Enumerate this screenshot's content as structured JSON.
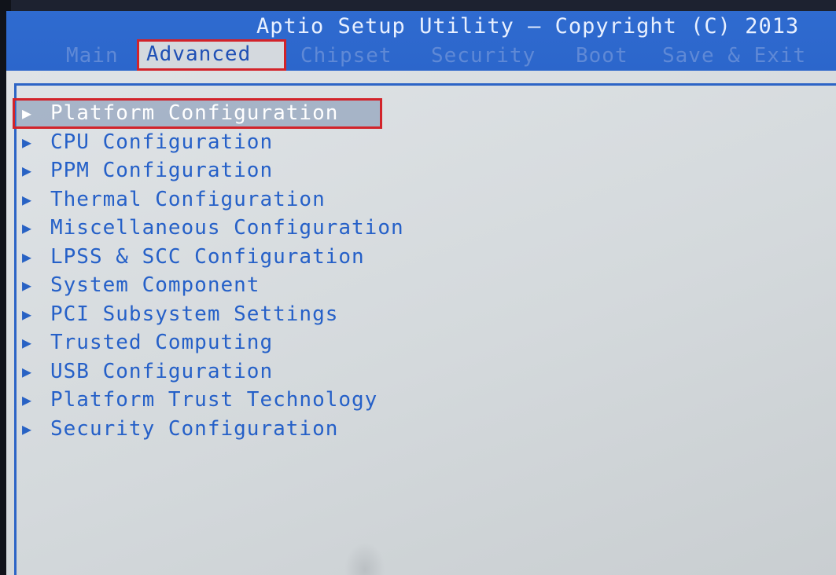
{
  "header": {
    "title": "Aptio Setup Utility – Copyright (C) 2013"
  },
  "tabs": [
    {
      "label": "Main"
    },
    {
      "label": "Advanced",
      "active": true
    },
    {
      "label": "Chipset"
    },
    {
      "label": "Security"
    },
    {
      "label": "Boot"
    },
    {
      "label": "Save & Exit"
    }
  ],
  "menu": {
    "items": [
      {
        "label": "Platform Configuration",
        "selected": true
      },
      {
        "label": "CPU Configuration"
      },
      {
        "label": "PPM Configuration"
      },
      {
        "label": "Thermal Configuration"
      },
      {
        "label": "Miscellaneous Configuration"
      },
      {
        "label": "LPSS & SCC Configuration"
      },
      {
        "label": "System Component"
      },
      {
        "label": "PCI Subsystem Settings"
      },
      {
        "label": "Trusted Computing"
      },
      {
        "label": "USB Configuration"
      },
      {
        "label": "Platform Trust Technology"
      },
      {
        "label": "Security Configuration"
      }
    ]
  },
  "icons": {
    "submenu_arrow": "triangle-right-icon"
  },
  "colors": {
    "header_bg": "#2c66cb",
    "content_bg": "#d4d9dc",
    "item_text": "#2560c8",
    "highlight_box": "#d2232a"
  }
}
